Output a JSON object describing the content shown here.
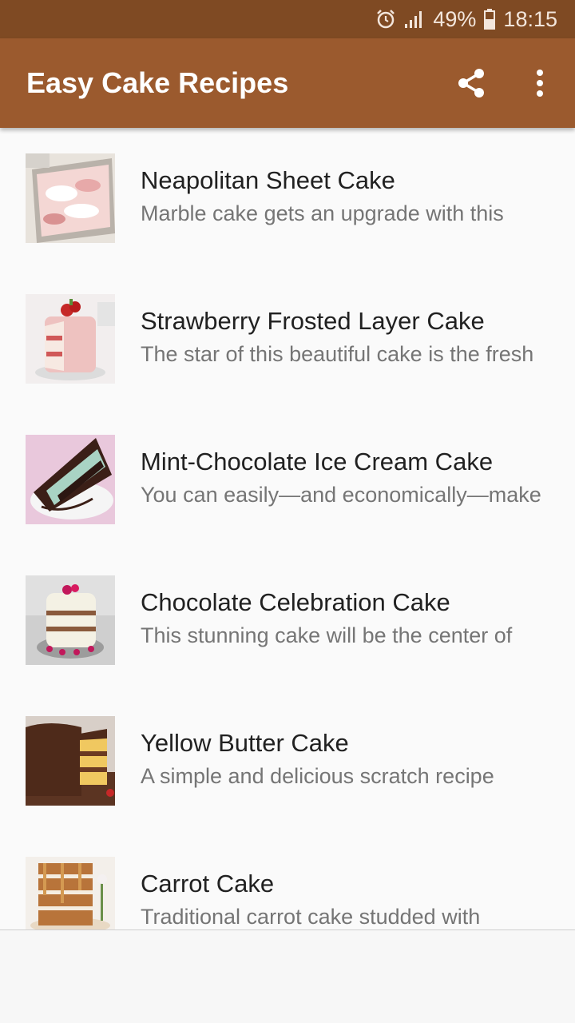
{
  "status_bar": {
    "battery": "49%",
    "time": "18:15",
    "icons": [
      "alarm-icon",
      "signal-icon",
      "battery-icon"
    ]
  },
  "app_bar": {
    "title": "Easy Cake Recipes",
    "actions": [
      "share-icon",
      "more-vert-icon"
    ]
  },
  "colors": {
    "status_bar": "#7f4a23",
    "app_bar": "#9b5a2e",
    "title_text": "#212121",
    "desc_text": "#757575"
  },
  "recipes": [
    {
      "title": "Neapolitan Sheet Cake",
      "description": "Marble cake gets an upgrade with this"
    },
    {
      "title": "Strawberry Frosted Layer Cake",
      "description": "The star of this beautiful cake is the fresh"
    },
    {
      "title": "Mint-Chocolate Ice Cream Cake",
      "description": "You can easily—and economically—make"
    },
    {
      "title": "Chocolate Celebration Cake",
      "description": "This stunning cake will be the center of"
    },
    {
      "title": "Yellow Butter Cake",
      "description": "A simple and delicious scratch recipe"
    },
    {
      "title": "Carrot Cake",
      "description": "Traditional carrot cake studded with"
    }
  ]
}
